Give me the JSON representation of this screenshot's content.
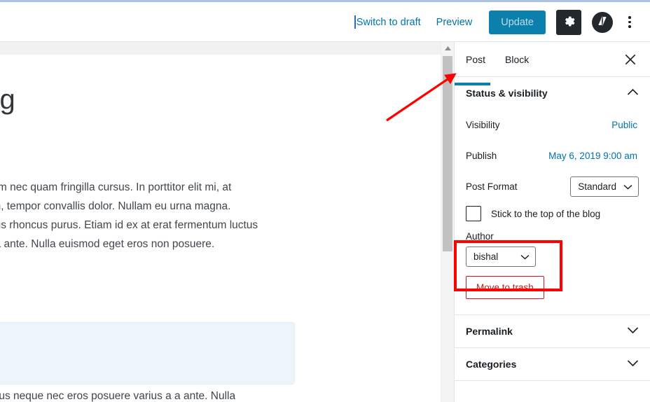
{
  "header": {
    "switch_to_draft": "Switch to draft",
    "preview": "Preview",
    "update": "Update",
    "settings_icon": "gear-icon",
    "jetpack_icon": "jetpack-logo-icon",
    "more_icon": "kebab-menu-icon"
  },
  "editor": {
    "title": "eling",
    "body_lines": [
      "iam a enim nec quam fringilla cursus. In porttitor elit mi, at",
      "c quam in, tempor convallis dolor. Nullam eu urna magna.",
      "s a, cursus rhoncus purus.  Etiam id ex at erat fermentum luctus",
      "varius a a ante. Nulla euismod eget eros non posuere."
    ],
    "caption": "Sed finibus neque nec eros posuere varius a a ante. Nulla",
    "embed_block": "embed-placeholder-block"
  },
  "sidebar": {
    "tabs": [
      {
        "label": "Post",
        "active": true
      },
      {
        "label": "Block",
        "active": false
      }
    ],
    "close_icon": "close-icon",
    "panels": [
      {
        "title": "Status & visibility",
        "expanded": true,
        "chevron": "chevron-up-icon"
      },
      {
        "title": "Permalink",
        "expanded": false,
        "chevron": "chevron-down-icon"
      },
      {
        "title": "Categories",
        "expanded": false,
        "chevron": "chevron-down-icon"
      }
    ],
    "visibility": {
      "label": "Visibility",
      "value": "Public"
    },
    "publish": {
      "label": "Publish",
      "value": "May 6, 2019 9:00 am"
    },
    "post_format": {
      "label": "Post Format",
      "value": "Standard"
    },
    "sticky": {
      "label": "Stick to the top of the blog",
      "checked": false
    },
    "author": {
      "label": "Author",
      "value": "bishal"
    },
    "move_to_trash": "Move to trash"
  },
  "scrollbar": {
    "up_arrow_icon": "scroll-up-arrow-icon"
  },
  "annotations": {
    "highlight_color": "#ff0000",
    "arrow": "red-arrow-pointing-to-post-tab",
    "box": "red-box-around-author-field"
  }
}
